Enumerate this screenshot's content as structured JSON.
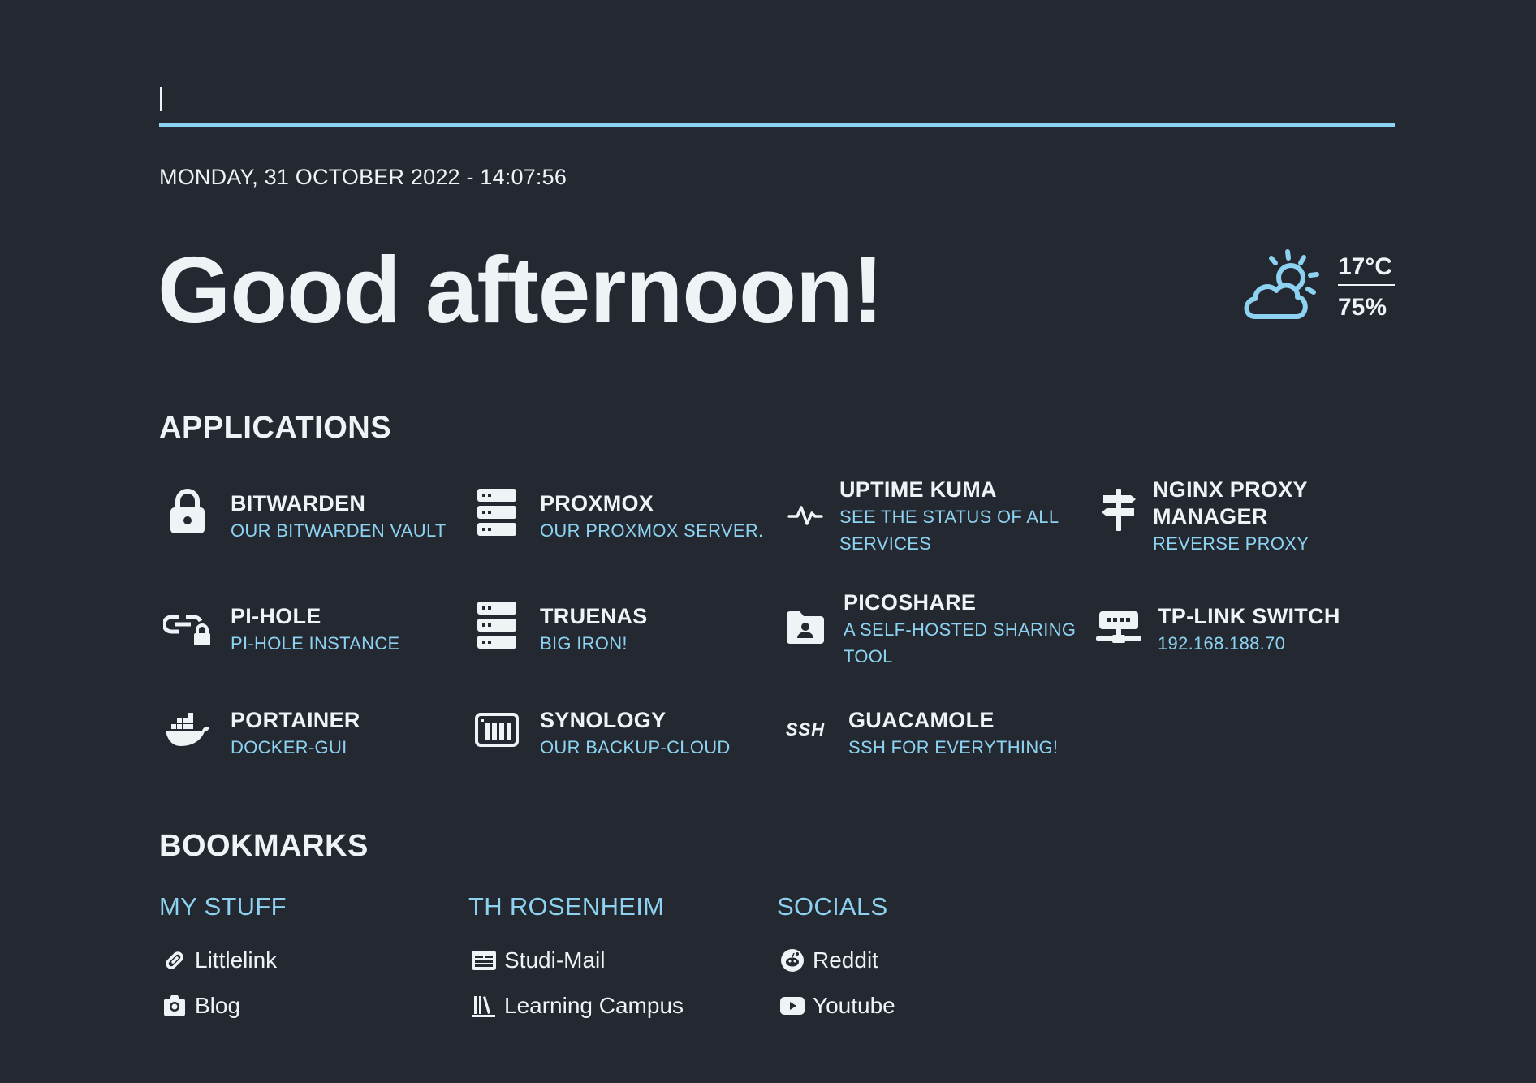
{
  "search": {
    "value": "",
    "placeholder": ""
  },
  "datetime": "MONDAY, 31 OCTOBER 2022 - 14:07:56",
  "greeting": "Good afternoon!",
  "weather": {
    "icon": "partly-cloudy-day-icon",
    "temperature": "17°C",
    "humidity": "75%"
  },
  "applications": {
    "title": "APPLICATIONS",
    "items": [
      {
        "name": "BITWARDEN",
        "desc": "OUR BITWARDEN VAULT",
        "icon": "lock-icon"
      },
      {
        "name": "PROXMOX",
        "desc": "OUR PROXMOX SERVER.",
        "icon": "server-icon"
      },
      {
        "name": "UPTIME KUMA",
        "desc1": "SEE THE STATUS OF ALL",
        "desc2": "SERVICES",
        "icon": "heartbeat-icon"
      },
      {
        "name1": "NGINX PROXY",
        "name2": "MANAGER",
        "desc": "REVERSE PROXY",
        "icon": "signpost-icon"
      },
      {
        "name": "PI-HOLE",
        "desc": "PI-HOLE INSTANCE",
        "icon": "link-lock-icon"
      },
      {
        "name": "TRUENAS",
        "desc": "BIG IRON!",
        "icon": "server-icon"
      },
      {
        "name": "PICOSHARE",
        "desc1": "A SELF-HOSTED SHARING",
        "desc2": "TOOL",
        "icon": "folder-user-icon"
      },
      {
        "name": "TP-LINK SWITCH",
        "desc": "192.168.188.70",
        "icon": "network-switch-icon"
      },
      {
        "name": "PORTAINER",
        "desc": "DOCKER-GUI",
        "icon": "docker-icon"
      },
      {
        "name": "SYNOLOGY",
        "desc": "OUR BACKUP-CLOUD",
        "icon": "nas-icon"
      },
      {
        "name": "GUACAMOLE",
        "desc": "SSH FOR EVERYTHING!",
        "icon": "ssh-icon",
        "icon_text": "SSH"
      }
    ]
  },
  "bookmarks": {
    "title": "BOOKMARKS",
    "groups": [
      {
        "title": "MY STUFF",
        "links": [
          {
            "label": "Littlelink",
            "icon": "link-icon"
          },
          {
            "label": "Blog",
            "icon": "camera-icon"
          }
        ]
      },
      {
        "title": "TH ROSENHEIM",
        "links": [
          {
            "label": "Studi-Mail",
            "icon": "id-card-icon"
          },
          {
            "label": "Learning Campus",
            "icon": "library-icon"
          }
        ]
      },
      {
        "title": "SOCIALS",
        "links": [
          {
            "label": "Reddit",
            "icon": "reddit-icon"
          },
          {
            "label": "Youtube",
            "icon": "youtube-icon"
          }
        ]
      }
    ]
  },
  "colors": {
    "background": "#232831",
    "foreground": "#eef3f6",
    "accent": "#8dd3f1"
  }
}
